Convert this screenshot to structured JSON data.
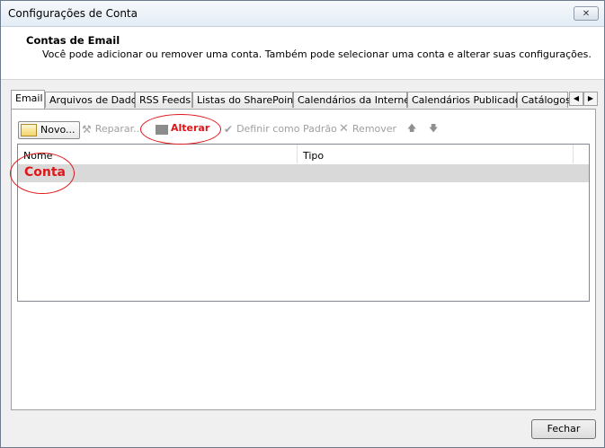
{
  "window": {
    "title": "Configurações de Conta",
    "close_glyph": "✕"
  },
  "header": {
    "title": "Contas de Email",
    "description": "Você pode adicionar ou remover uma conta. Também pode selecionar uma conta e alterar suas configurações."
  },
  "tabs": [
    {
      "label": "Email"
    },
    {
      "label": "Arquivos de Dados"
    },
    {
      "label": "RSS Feeds"
    },
    {
      "label": "Listas do SharePoint"
    },
    {
      "label": "Calendários da Internet"
    },
    {
      "label": "Calendários Publicados"
    },
    {
      "label": "Catálogos"
    }
  ],
  "tab_scroll": {
    "left": "◀",
    "right": "▶"
  },
  "toolbar": {
    "novo": "Novo...",
    "reparar": "Reparar...",
    "alterar": "Alterar",
    "definir_padrao": "Definir como Padrão",
    "remover": "Remover",
    "up_glyph": "🡅",
    "down_glyph": "🡇"
  },
  "list": {
    "columns": [
      "Nome",
      "Tipo"
    ],
    "rows": [
      {
        "name": "",
        "type": ""
      }
    ]
  },
  "annotations": {
    "alterar_label": "Alterar",
    "conta_label": "Conta",
    "color": "#e0171a"
  },
  "footer": {
    "close_button": "Fechar"
  }
}
